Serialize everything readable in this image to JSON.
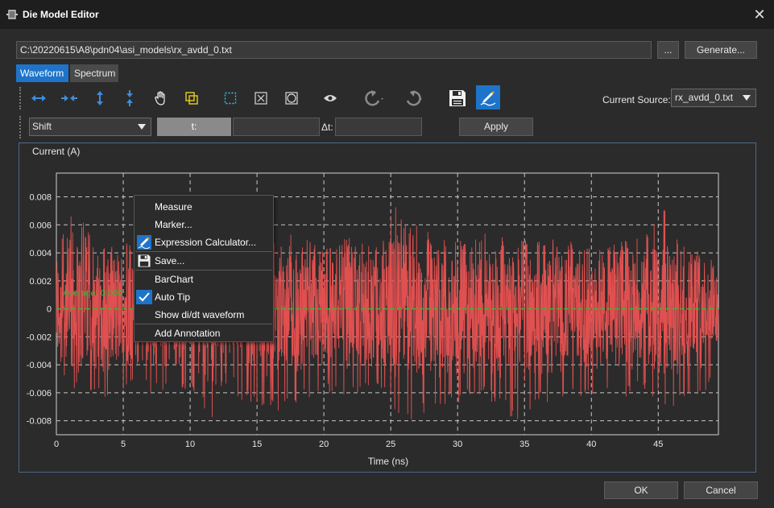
{
  "window": {
    "title": "Die Model Editor",
    "icon": "resistor-icon",
    "close_label": "✕"
  },
  "file": {
    "path": "C:\\20220615\\A8\\pdn04\\asi_models\\rx_avdd_0.txt",
    "browse_label": "...",
    "generate_label": "Generate..."
  },
  "tabs": [
    {
      "label": "Waveform",
      "active": true
    },
    {
      "label": "Spectrum",
      "active": false
    }
  ],
  "toolbar": {
    "icons": [
      "zoom-x-in-icon",
      "zoom-x-out-icon",
      "zoom-y-in-icon",
      "zoom-y-out-icon",
      "pan-hand-icon",
      "zoom-box-icon",
      "select-region-icon",
      "fit-all-icon",
      "fit-circle-icon",
      "visibility-eye-icon",
      "undo-icon",
      "redo-icon",
      "save-icon",
      "edit-pen-icon"
    ],
    "current_source_label": "Current Source:",
    "current_source_value": "rx_avdd_0.txt"
  },
  "shift_row": {
    "mode_value": "Shift",
    "t_label": "t:",
    "dt_label": "Δt:",
    "apply_label": "Apply"
  },
  "colors": {
    "accent": "#1e74c8",
    "waveform": "#e05050",
    "average_line": "#3cb43c",
    "grid": "#c8c8c8"
  },
  "chart_data": {
    "type": "line",
    "ylabel": "Current (A)",
    "xlabel": "Time (ns)",
    "xlim": [
      0,
      49.5
    ],
    "ylim": [
      -0.009,
      0.0097
    ],
    "x_ticks": [
      0,
      5,
      10,
      15,
      20,
      25,
      30,
      35,
      40,
      45
    ],
    "x_tick_labels": [
      "0",
      "5",
      "10",
      "15",
      "20",
      "25",
      "30",
      "35",
      "40",
      "45"
    ],
    "y_ticks": [
      0.008,
      0.006,
      0.004,
      0.002,
      0,
      -0.002,
      -0.004,
      -0.006,
      -0.008
    ],
    "y_tick_labels": [
      "0.008",
      "0.006",
      "0.004",
      "0.002",
      "0",
      "-0.002",
      "-0.004",
      "-0.006",
      "-0.008"
    ],
    "grid": true,
    "average_value": 0,
    "average_label": "Average: 0.000",
    "series": [
      {
        "envelope_max": [
          [
            0,
            0.0052
          ],
          [
            1,
            0.0062
          ],
          [
            1.3,
            0.0088
          ],
          [
            2,
            0.0062
          ],
          [
            3,
            0.0045
          ],
          [
            5,
            0.0046
          ],
          [
            6,
            0.0052
          ],
          [
            8,
            0.0045
          ],
          [
            10,
            0.0035
          ],
          [
            12,
            0.0048
          ],
          [
            14,
            0.0045
          ],
          [
            16,
            0.0052
          ],
          [
            18,
            0.0055
          ],
          [
            20,
            0.0045
          ],
          [
            22,
            0.0052
          ],
          [
            24,
            0.0045
          ],
          [
            25.5,
            0.0081
          ],
          [
            26,
            0.0064
          ],
          [
            28,
            0.0055
          ],
          [
            30,
            0.0048
          ],
          [
            32,
            0.0055
          ],
          [
            34,
            0.0052
          ],
          [
            36,
            0.0048
          ],
          [
            38,
            0.0052
          ],
          [
            40,
            0.0045
          ],
          [
            42,
            0.0048
          ],
          [
            44,
            0.0052
          ],
          [
            45.5,
            0.0072
          ],
          [
            46,
            0.0058
          ],
          [
            48,
            0.0038
          ],
          [
            49.5,
            0.0035
          ]
        ],
        "envelope_min": [
          [
            0,
            -0.0062
          ],
          [
            1,
            -0.0075
          ],
          [
            2,
            -0.0065
          ],
          [
            4,
            -0.0065
          ],
          [
            6,
            -0.0058
          ],
          [
            8,
            -0.0062
          ],
          [
            10,
            -0.0058
          ],
          [
            12,
            -0.0085
          ],
          [
            14,
            -0.0065
          ],
          [
            16,
            -0.0075
          ],
          [
            18,
            -0.0068
          ],
          [
            20,
            -0.0062
          ],
          [
            22,
            -0.0065
          ],
          [
            24,
            -0.0058
          ],
          [
            26,
            -0.0082
          ],
          [
            28,
            -0.0072
          ],
          [
            30,
            -0.0068
          ],
          [
            32,
            -0.0062
          ],
          [
            34,
            -0.0078
          ],
          [
            34.5,
            -0.0085
          ],
          [
            36,
            -0.0068
          ],
          [
            38,
            -0.0065
          ],
          [
            40,
            -0.0062
          ],
          [
            42,
            -0.0068
          ],
          [
            44,
            -0.0058
          ],
          [
            46,
            -0.0075
          ],
          [
            48,
            -0.0062
          ],
          [
            49.5,
            -0.0055
          ]
        ]
      }
    ]
  },
  "context_menu": {
    "items": [
      {
        "label": "Measure",
        "icon": ""
      },
      {
        "label": "Marker...",
        "icon": ""
      },
      {
        "label": "Expression Calculator...",
        "icon": "calculator-pen-icon"
      },
      {
        "label": "Save...",
        "icon": "save-icon"
      },
      {
        "label": "BarChart",
        "icon": ""
      },
      {
        "label": "Auto Tip",
        "icon": "checkmark-icon"
      },
      {
        "label": "Show di/dt waveform",
        "icon": ""
      },
      {
        "label": "Add Annotation",
        "icon": ""
      }
    ]
  },
  "footer": {
    "ok_label": "OK",
    "cancel_label": "Cancel"
  }
}
